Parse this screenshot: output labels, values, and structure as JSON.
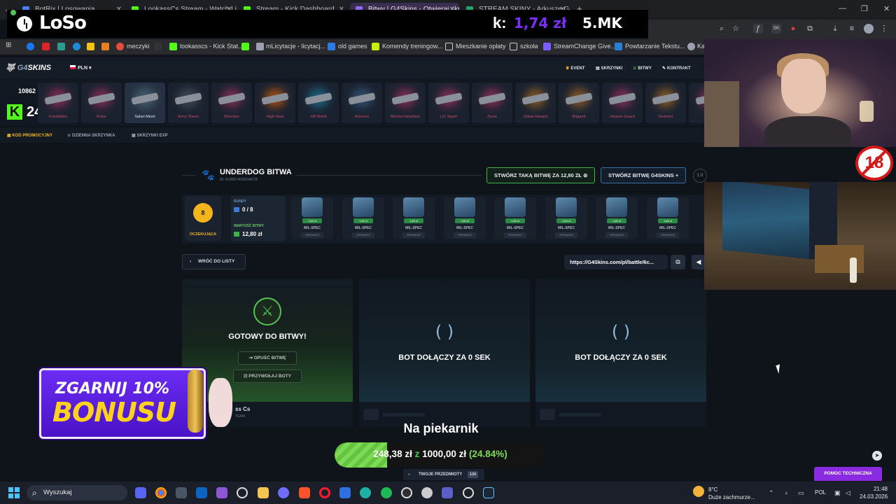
{
  "browser": {
    "tabs": [
      {
        "title": "BotRix | Losowania",
        "color": "#4c7cff"
      },
      {
        "title": "LookassCs Stream - Watch Live",
        "color": "#53fc18"
      },
      {
        "title": "Stream - Kick Dashboard",
        "color": "#53fc18"
      },
      {
        "title": "Bitwy | G4Skins - Otwieraj skrz",
        "color": "#8a6cff"
      },
      {
        "title": "STREAM SKINY - Arkusze Goog",
        "color": "#23a566"
      }
    ],
    "new_tab": "+"
  },
  "obs_overlay": {
    "logo_text": "LoSo",
    "kick_symbol": "k:",
    "amount": "1,74 zł",
    "views": "5.MK"
  },
  "bookmarks": [
    "meczyki",
    "lookasscs - Kick Stat...",
    "mLicytacje - licytacj...",
    "old games",
    "Komendy treningow...",
    "Mieszkanie opłaty",
    "szkoła",
    "StreamChange Give...",
    "Powtarzanie Tekstu...",
    "Ka"
  ],
  "site": {
    "logo_a": "G4",
    "logo_b": "SKINS",
    "currency": "PLN",
    "nav": [
      "EVENT",
      "SKRZYNKI",
      "BITWY",
      "KONTRAKT",
      "RANKING"
    ],
    "balance": "10862",
    "kick_count": "24",
    "cases": [
      {
        "name": "Frostbitten",
        "glow": "#c3356b"
      },
      {
        "name": "Pulse",
        "glow": "#c3356b"
      },
      {
        "name": "Safari Mesh",
        "glow": "#5f7b93",
        "selected": true
      },
      {
        "name": "Army Sheen",
        "glow": "#56606e"
      },
      {
        "name": "Directive",
        "glow": "#c3356b"
      },
      {
        "name": "High Heat",
        "glow": "#ff6a00"
      },
      {
        "name": "Off World",
        "glow": "#1f8fb3"
      },
      {
        "name": "Acheron",
        "glow": "#3f6f9a"
      },
      {
        "name": "Mecha Industries",
        "glow": "#c3356b"
      },
      {
        "name": "LiC Squirt",
        "glow": "#c3356b"
      },
      {
        "name": "Zyrex",
        "glow": "#c3356b"
      },
      {
        "name": "Urban Hazard",
        "glow": "#c87a22"
      },
      {
        "name": "Brigand",
        "glow": "#c87a22"
      },
      {
        "name": "Heaven Guard",
        "glow": "#c3356b"
      },
      {
        "name": "Demeter",
        "glow": "#c87a22"
      },
      {
        "name": "Phi",
        "glow": "#c3356b"
      }
    ],
    "sub_links": [
      "KOD PROMOCYJNY",
      "DZIENNA SKRZYNKA",
      "SKRZYNKI EXP"
    ]
  },
  "battle": {
    "title": "UNDERDOG BITWA",
    "id": "ID: 6C8857462669A578",
    "create_same": "STWÓRZ TAKĄ BITWĘ ZA 12,80 ZŁ",
    "create_g4": "STWÓRZ BITWĘ G4SKINS",
    "version": "1.0",
    "status_count": "8",
    "status_label": "OCZEKUJĄCA",
    "rounds_label": "RUNDY",
    "rounds_value": "0 / 8",
    "value_label": "WARTOŚĆ BITWY",
    "value_amount": "12,80 zł",
    "round_cases": [
      {
        "price": "1,60 zł",
        "rarity": "MIL-SPEC",
        "check": "SPRAWDŹ"
      },
      {
        "price": "1,60 zł",
        "rarity": "MIL-SPEC",
        "check": "SPRAWDŹ"
      },
      {
        "price": "1,60 zł",
        "rarity": "MIL-SPEC",
        "check": "SPRAWDŹ"
      },
      {
        "price": "1,60 zł",
        "rarity": "MIL-SPEC",
        "check": "SPRAWDŹ"
      },
      {
        "price": "1,60 zł",
        "rarity": "MIL-SPEC",
        "check": "SPRAWDŹ"
      },
      {
        "price": "1,60 zł",
        "rarity": "MIL-SPEC",
        "check": "SPRAWDŹ"
      },
      {
        "price": "1,60 zł",
        "rarity": "MIL-SPEC",
        "check": "SPRAWDŹ"
      },
      {
        "price": "1,60 zł",
        "rarity": "MIL-SPEC",
        "check": "SPRAWDŹ"
      }
    ],
    "back_label": "WRÓĆ DO LISTY",
    "link": "https://G4Skins.com/pl/battle/6c...",
    "ready_label": "GOTOWY DO BITWY!",
    "leave_label": "OPUŚĆ BITWĘ",
    "call_bots_label": "PRZYWOŁAJ BOTY",
    "bot_label": "BOT DOŁĄCZY ZA 0 SEK",
    "player_name": "ss Cs",
    "player_team": "TEAM"
  },
  "promo": {
    "line1": "ZGARNIJ 10%",
    "line2": "BONUSU"
  },
  "goal": {
    "title": "Na piekarnik",
    "current": "248,38 zł",
    "sep": "z",
    "target": "1000,00 zł",
    "percent_text": "(24.84%)",
    "percent": 24.84
  },
  "footer": {
    "items_label": "TWOJE PRZEDMIOTY",
    "items_count": "130",
    "help_label": "POMOC TECHNICZNA"
  },
  "badge18": "18",
  "taskbar": {
    "search_placeholder": "Wyszukaj",
    "weather_temp": "8°C",
    "weather_desc": "Duże zachmurze...",
    "lang": "POL",
    "time": "21:48",
    "date": "24.03.2026"
  }
}
